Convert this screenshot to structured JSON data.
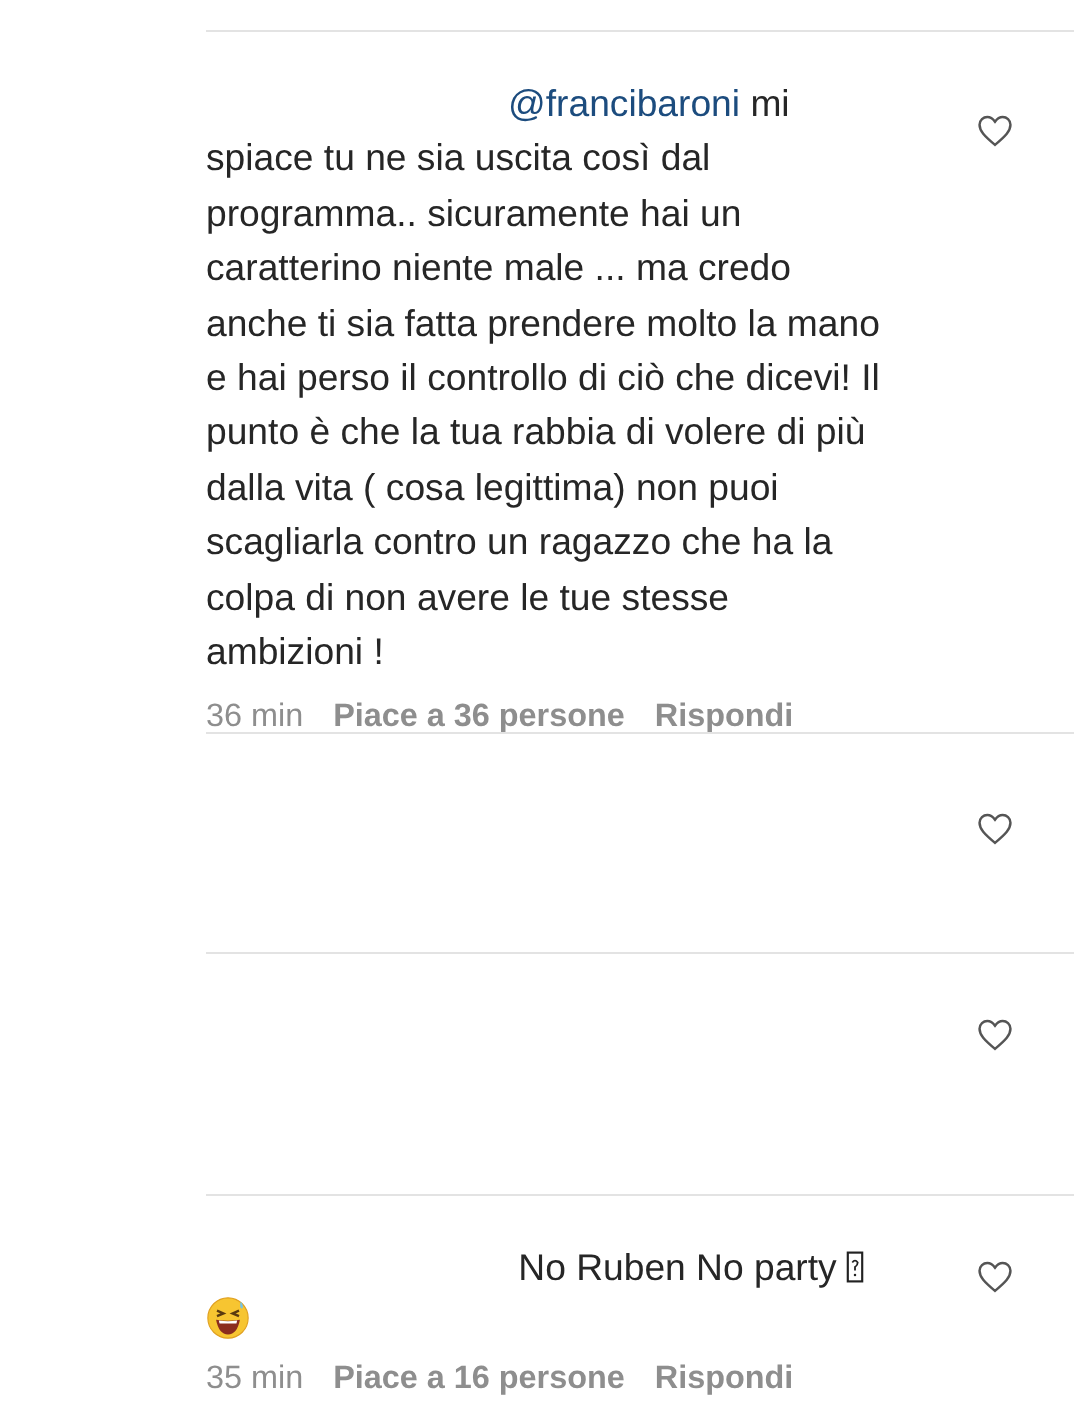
{
  "comments": [
    {
      "mention": "@francibaroni",
      "text": "mi spiace tu ne sia uscita così dal programma.. sicuramente hai un caratterino niente male ... ma credo anche ti sia fatta prendere molto la mano e hai perso il controllo di ciò che dicevi! Il punto è che la tua rabbia di volere di più dalla vita ( cosa legittima) non puoi scagliarla contro un ragazzo che ha la colpa di non avere le tue stesse ambizioni !",
      "time": "36 min",
      "likes": "Piace a 36 persone",
      "reply": "Rispondi",
      "liked": false
    },
    {
      "liked": false
    },
    {
      "liked": false
    },
    {
      "text": "No Ruben No party",
      "missing_glyph": true,
      "emoji": true,
      "time": "35 min",
      "likes": "Piace a 16 persone",
      "reply": "Rispondi",
      "liked": false
    }
  ]
}
